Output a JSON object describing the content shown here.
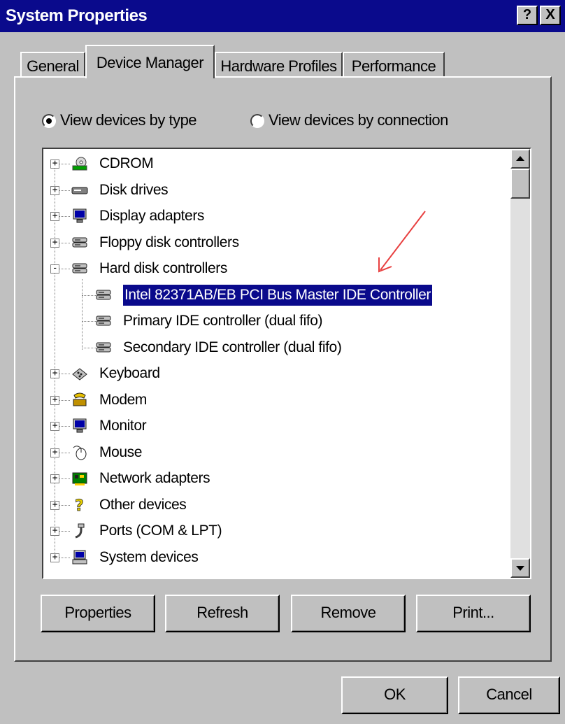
{
  "window": {
    "title": "System Properties",
    "help_button": "?",
    "close_button": "X"
  },
  "tabs": [
    {
      "label": "General"
    },
    {
      "label": "Device Manager"
    },
    {
      "label": "Hardware Profiles"
    },
    {
      "label": "Performance"
    }
  ],
  "view_options": {
    "by_type_label": "View devices by type",
    "by_connection_label": "View devices by connection",
    "selected": "by_type"
  },
  "tree": {
    "items": [
      {
        "label": "CDROM",
        "icon": "cdrom-icon",
        "expander": "+"
      },
      {
        "label": "Disk drives",
        "icon": "disk-drive-icon",
        "expander": "+"
      },
      {
        "label": "Display adapters",
        "icon": "monitor-icon",
        "expander": "+"
      },
      {
        "label": "Floppy disk controllers",
        "icon": "controller-icon",
        "expander": "+"
      },
      {
        "label": "Hard disk controllers",
        "icon": "controller-icon",
        "expander": "-"
      },
      {
        "label": "Intel 82371AB/EB PCI Bus Master IDE Controller",
        "icon": "controller-icon",
        "child": true,
        "selected": true
      },
      {
        "label": "Primary IDE controller (dual fifo)",
        "icon": "controller-icon",
        "child": true
      },
      {
        "label": "Secondary IDE controller (dual fifo)",
        "icon": "controller-icon",
        "child": true
      },
      {
        "label": "Keyboard",
        "icon": "keyboard-icon",
        "expander": "+"
      },
      {
        "label": "Modem",
        "icon": "modem-icon",
        "expander": "+"
      },
      {
        "label": "Monitor",
        "icon": "monitor-icon",
        "expander": "+"
      },
      {
        "label": "Mouse",
        "icon": "mouse-icon",
        "expander": "+"
      },
      {
        "label": "Network adapters",
        "icon": "network-adapter-icon",
        "expander": "+"
      },
      {
        "label": "Other devices",
        "icon": "question-mark-icon",
        "expander": "+"
      },
      {
        "label": "Ports (COM & LPT)",
        "icon": "port-icon",
        "expander": "+"
      },
      {
        "label": "System devices",
        "icon": "computer-icon",
        "expander": "+"
      }
    ]
  },
  "buttons": {
    "properties": "Properties",
    "refresh": "Refresh",
    "remove": "Remove",
    "print": "Print...",
    "ok": "OK",
    "cancel": "Cancel"
  },
  "colors": {
    "titlebar": "#0a0a8c",
    "selection": "#0a0a8c",
    "annotation_arrow": "#e84040"
  }
}
